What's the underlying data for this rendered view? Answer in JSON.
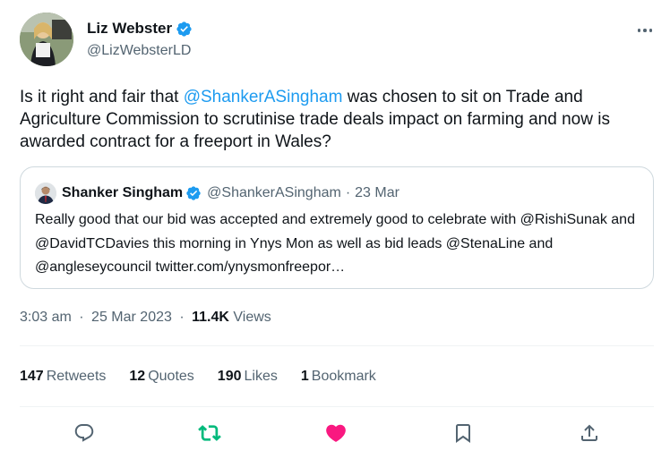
{
  "author": {
    "name": "Liz Webster",
    "handle": "@LizWebsterLD",
    "verified": true
  },
  "tweet": {
    "text_parts": [
      "Is it right and fair that ",
      "@ShankerASingham",
      " was chosen to sit on Trade and Agriculture Commission to scrutinise trade deals impact on farming and now is awarded contract for a freeport in Wales?"
    ]
  },
  "quoted_tweet": {
    "name": "Shanker Singham",
    "handle": "@ShankerASingham",
    "separator": "·",
    "date": "23 Mar",
    "text": "Really good that our bid was accepted and extremely good to celebrate with @RishiSunak and @DavidTCDavies this morning in Ynys Mon as well as bid leads @StenaLine and @angleseycouncil twitter.com/ynysmonfreepor…"
  },
  "meta": {
    "time": "3:03 am",
    "separator": "·",
    "date": "25 Mar 2023",
    "separator2": "·",
    "views_count": "11.4K",
    "views_label": "Views"
  },
  "stats": {
    "retweets_count": "147",
    "retweets_label": "Retweets",
    "quotes_count": "12",
    "quotes_label": "Quotes",
    "likes_count": "190",
    "likes_label": "Likes",
    "bookmarks_count": "1",
    "bookmarks_label": "Bookmark"
  },
  "actions": {
    "reply_icon": "reply-icon",
    "retweet_icon": "retweet-icon",
    "like_icon": "heart-icon",
    "bookmark_icon": "bookmark-icon",
    "share_icon": "share-icon"
  },
  "colors": {
    "accent": "#1d9bf0",
    "retweet_active": "#00ba7c",
    "like_active": "#f91880",
    "secondary_text": "#536471",
    "primary_text": "#0f1419",
    "border": "#cfd9de"
  }
}
